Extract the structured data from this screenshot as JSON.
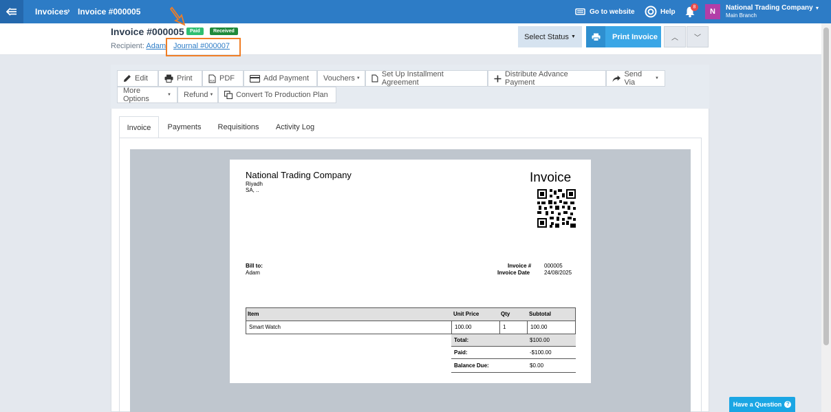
{
  "topbar": {
    "breadcrumb_1": "Invoices",
    "breadcrumb_2": "Invoice #000005",
    "go_website": "Go to website",
    "help": "Help",
    "notif_count": "8",
    "avatar": "N",
    "company": "National Trading Company",
    "branch": "Main Branch"
  },
  "header": {
    "title": "Invoice #000005",
    "badge_paid": "Paid",
    "badge_received": "Received",
    "recipient_label": "Recipient:",
    "recipient": "Adam",
    "journal": "Journal #000007",
    "select_status": "Select Status",
    "print_invoice": "Print Invoice"
  },
  "colors": {
    "topbar": "#2d7cc6",
    "paid": "#2fbf71",
    "received": "#1f8a3a",
    "highlight": "#f07d24"
  },
  "toolbar": {
    "edit": "Edit",
    "print": "Print",
    "pdf": "PDF",
    "add_payment": "Add Payment",
    "vouchers": "Vouchers",
    "installment": "Set Up Installment Agreement",
    "distribute": "Distribute Advance Payment",
    "send_via": "Send Via",
    "more_options": "More Options",
    "refund": "Refund",
    "convert": "Convert To Production Plan"
  },
  "tabs": {
    "invoice": "Invoice",
    "payments": "Payments",
    "requisitions": "Requisitions",
    "activity": "Activity Log"
  },
  "doc": {
    "company": "National Trading Company",
    "city": "Riyadh",
    "country": "SA, ..",
    "heading": "Invoice",
    "bill_to": "Bill to:",
    "bill_name": "Adam",
    "inv_no_label": "Invoice #",
    "inv_no": "000005",
    "inv_date_label": "Invoice Date",
    "inv_date": "24/08/2025",
    "headers": {
      "item": "Item",
      "unit_price": "Unit Price",
      "qty": "Qty",
      "subtotal": "Subtotal"
    },
    "row": {
      "item": "Smart Watch",
      "unit_price": "100.00",
      "qty": "1",
      "subtotal": "100.00"
    },
    "total_label": "Total:",
    "total": "$100.00",
    "paid_label": "Paid:",
    "paid": "-$100.00",
    "balance_label": "Balance Due:",
    "balance": "$0.00"
  },
  "help_button": "Have a Question"
}
